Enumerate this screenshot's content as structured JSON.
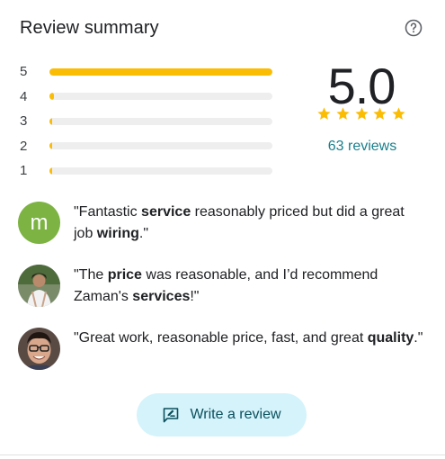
{
  "header": {
    "title": "Review summary",
    "help_icon": "help-circle-icon"
  },
  "rating_distribution": [
    {
      "stars": "5",
      "fraction": 1.0
    },
    {
      "stars": "4",
      "fraction": 0.02
    },
    {
      "stars": "3",
      "fraction": 0.0
    },
    {
      "stars": "2",
      "fraction": 0.0
    },
    {
      "stars": "1",
      "fraction": 0.0
    }
  ],
  "summary": {
    "score": "5.0",
    "stars": 5,
    "review_count": "63 reviews"
  },
  "snippets": [
    {
      "avatar_type": "letter",
      "avatar_letter": "m",
      "avatar_color": "#7cb342",
      "parts": [
        {
          "t": "\"Fantastic ",
          "b": false
        },
        {
          "t": "service",
          "b": true
        },
        {
          "t": " reasonably priced but did a great job ",
          "b": false
        },
        {
          "t": "wiring",
          "b": true
        },
        {
          "t": ".\"",
          "b": false
        }
      ]
    },
    {
      "avatar_type": "photo",
      "parts": [
        {
          "t": "\"The ",
          "b": false
        },
        {
          "t": "price",
          "b": true
        },
        {
          "t": " was reasonable, and I’d recommend Zaman's ",
          "b": false
        },
        {
          "t": "services",
          "b": true
        },
        {
          "t": "!\"",
          "b": false
        }
      ]
    },
    {
      "avatar_type": "photo",
      "parts": [
        {
          "t": "\"Great work, reasonable price, fast, and great ",
          "b": false
        },
        {
          "t": "quality",
          "b": true
        },
        {
          "t": ".\"",
          "b": false
        }
      ]
    }
  ],
  "write_review": {
    "label": "Write a review",
    "icon": "rate-review-icon"
  },
  "colors": {
    "bar_fill": "#fbbc04",
    "bar_track": "#eeeeee",
    "link": "#1a7f8c",
    "button_bg": "#d4f3fb"
  }
}
